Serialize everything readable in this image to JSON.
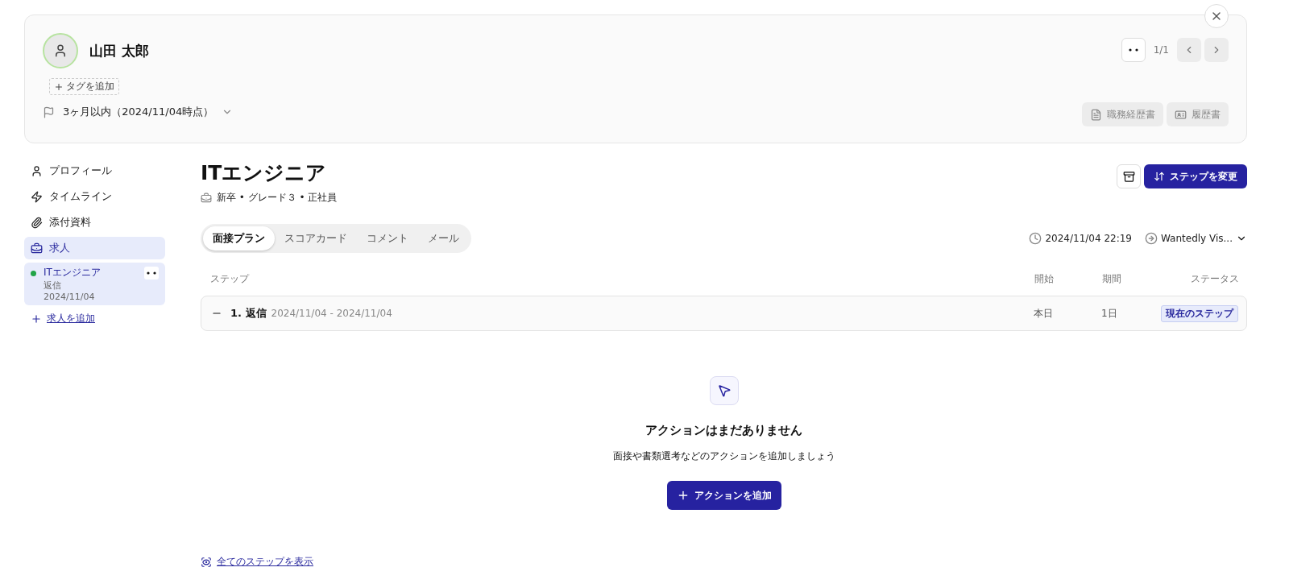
{
  "candidate": {
    "name": "山田 太郎",
    "add_tag": "タグを追加",
    "period": "3ヶ月以内（2024/11/04時点）",
    "pager": "1/1",
    "documents": [
      {
        "kind": "cv",
        "label": "職務経歴書"
      },
      {
        "kind": "resume",
        "label": "履歴書"
      }
    ]
  },
  "sidebar": {
    "items": [
      {
        "kind": "profile",
        "label": "プロフィール",
        "selected": false
      },
      {
        "kind": "timeline",
        "label": "タイムライン",
        "selected": false
      },
      {
        "kind": "attachment",
        "label": "添付資料",
        "selected": false
      },
      {
        "kind": "job",
        "label": "求人",
        "selected": true
      }
    ],
    "jobs": [
      {
        "title": "ITエンジニア",
        "step": "返信",
        "date": "2024/11/04",
        "color": "#22a447",
        "selected": true
      }
    ],
    "add_job": "求人を追加"
  },
  "job": {
    "title": "ITエンジニア",
    "meta": "新卒 • グレード３ • 正社員",
    "change_step": "ステップを変更"
  },
  "tabs": [
    {
      "label": "面接プラン",
      "selected": true
    },
    {
      "label": "スコアカード",
      "selected": false
    },
    {
      "label": "コメント",
      "selected": false
    },
    {
      "label": "メール",
      "selected": false
    }
  ],
  "updated": "2024/11/04 22:19",
  "source": "Wantedly Vis...",
  "table": {
    "columns": [
      "ステップ",
      "開始",
      "期間",
      "ステータス"
    ],
    "rows": [
      {
        "step": "1. 返信",
        "range": "2024/11/04 - 2024/11/04",
        "start": "本日",
        "duration": "1日",
        "status": "現在のステップ",
        "expanded": true
      }
    ]
  },
  "empty": {
    "title": "アクションはまだありません",
    "text": "面接や書類選考などのアクションを追加しましょう",
    "button": "アクションを追加"
  },
  "show_all": "全てのステップを表示"
}
